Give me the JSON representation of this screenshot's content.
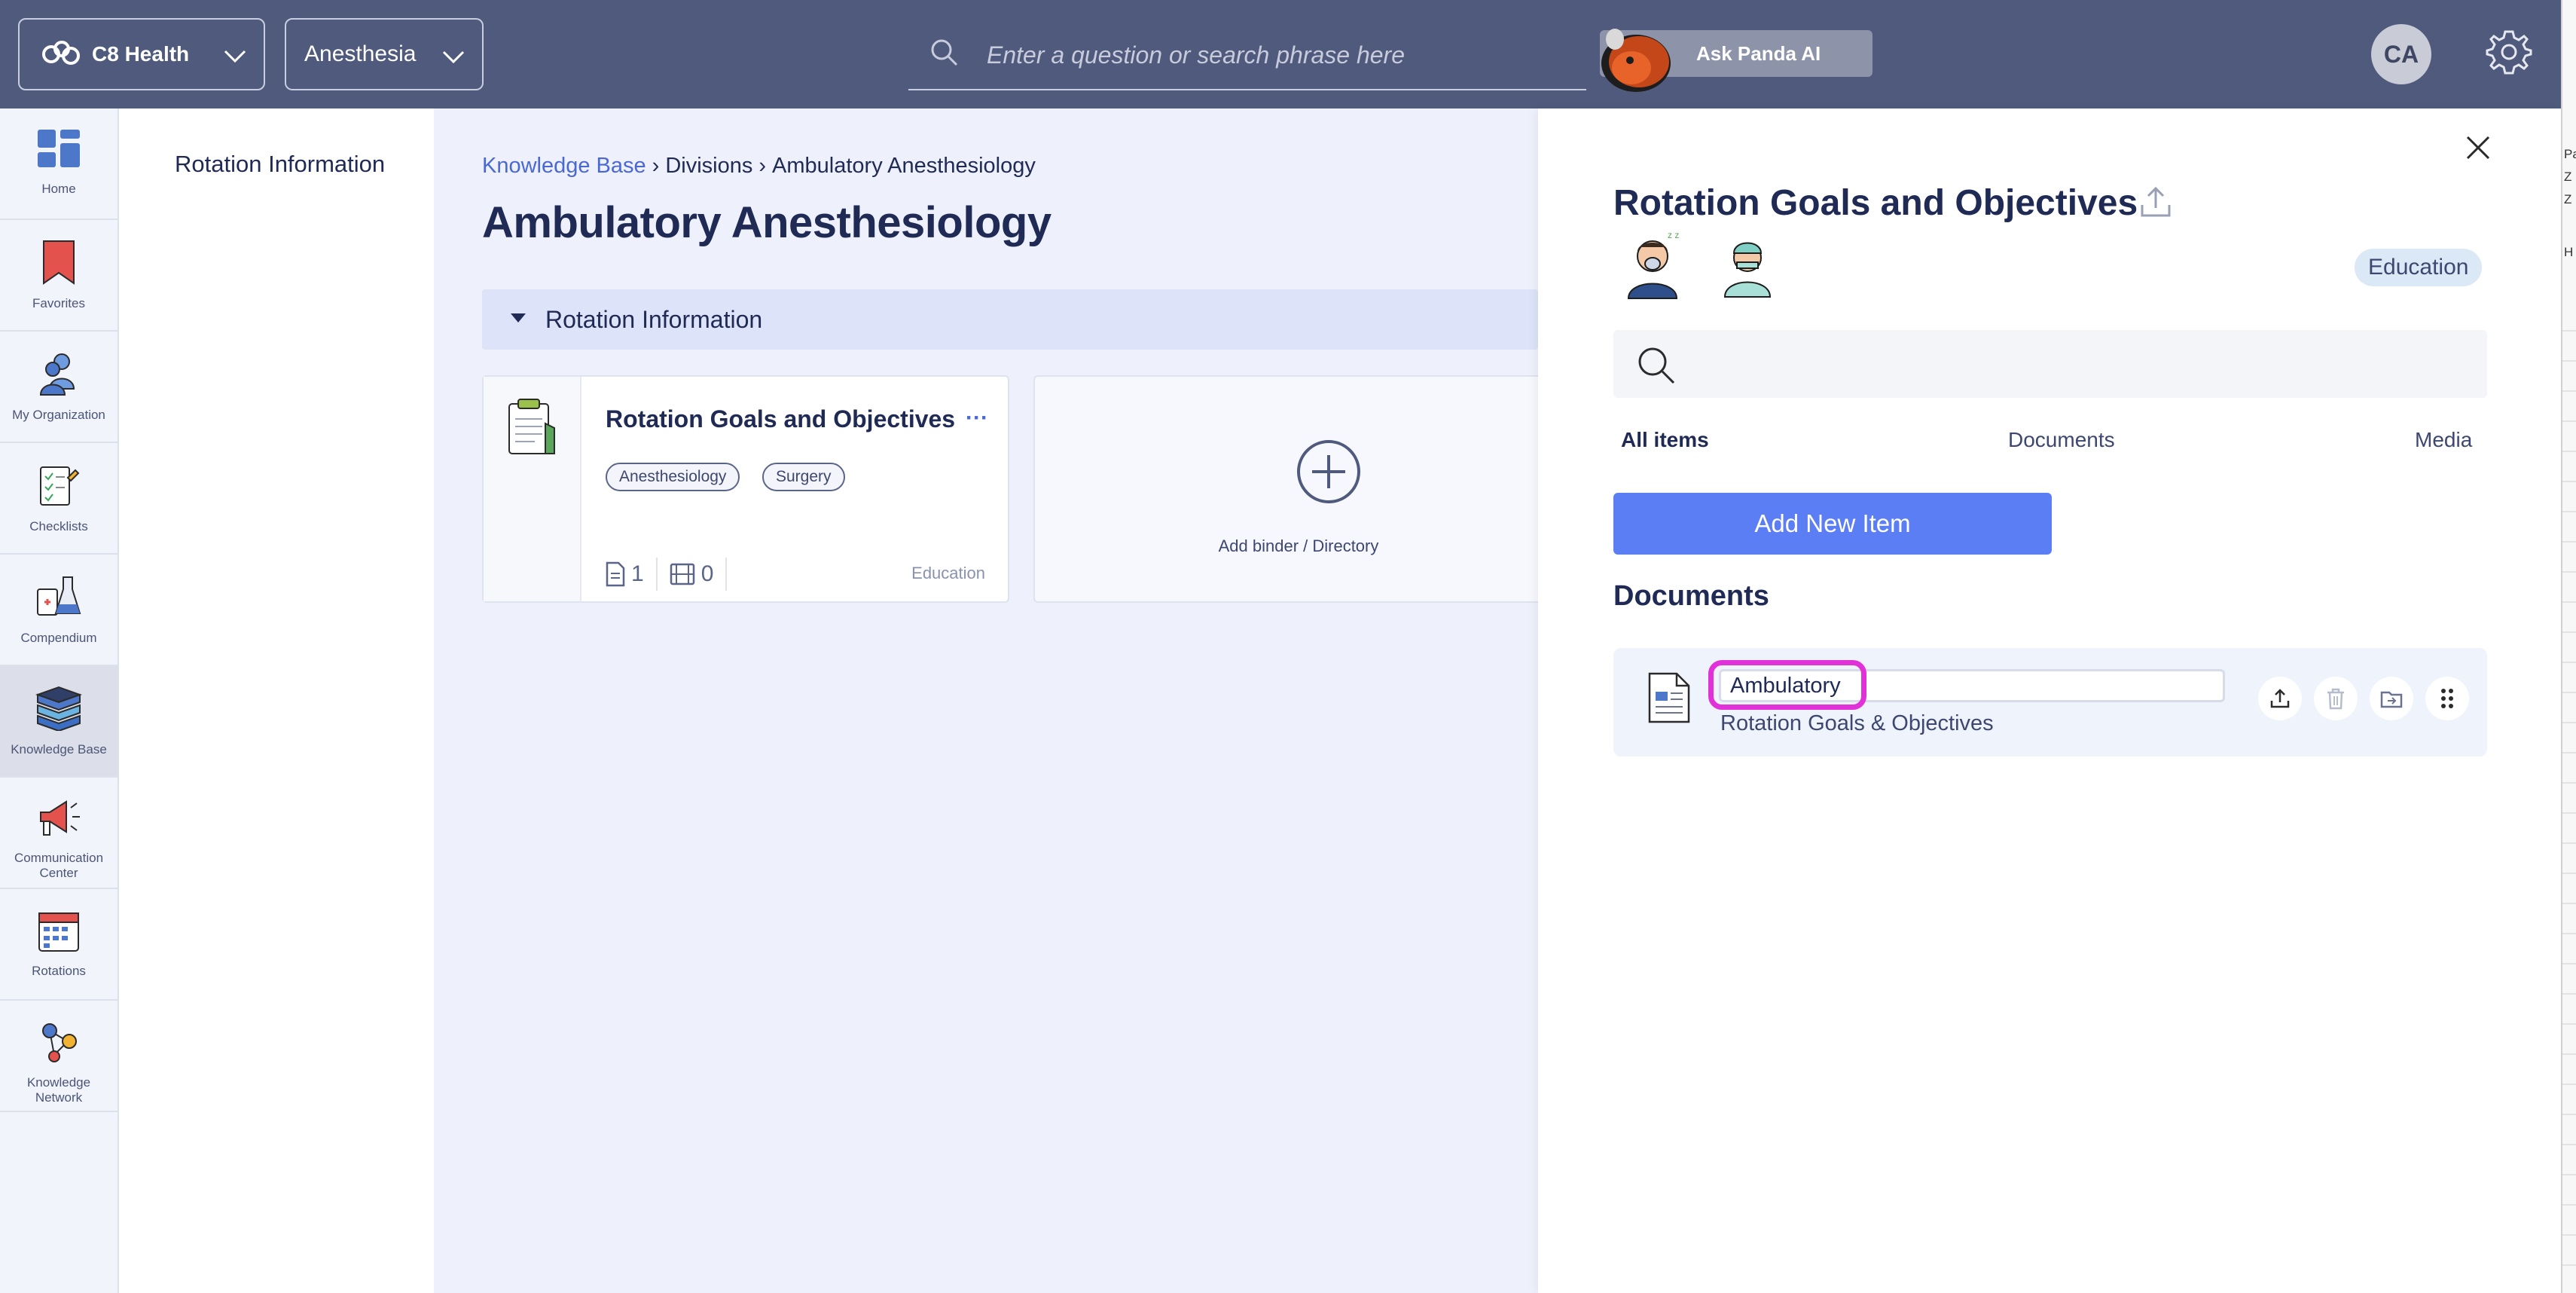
{
  "topbar": {
    "org_name": "C8 Health",
    "department": "Anesthesia",
    "search_placeholder": "Enter a question or search phrase here",
    "panda_label": "Ask Panda AI",
    "user_initials": "CA"
  },
  "sidebar": {
    "items": [
      {
        "label": "Home",
        "icon": "home-grid-icon"
      },
      {
        "label": "Favorites",
        "icon": "bookmark-icon"
      },
      {
        "label": "My Organization",
        "icon": "people-icon"
      },
      {
        "label": "Checklists",
        "icon": "checklist-icon"
      },
      {
        "label": "Compendium",
        "icon": "flask-icon"
      },
      {
        "label": "Knowledge Base",
        "icon": "books-icon"
      },
      {
        "label": "Communication Center",
        "icon": "megaphone-icon"
      },
      {
        "label": "Rotations",
        "icon": "calendar-icon"
      },
      {
        "label": "Knowledge Network",
        "icon": "network-icon"
      }
    ],
    "active": "Knowledge Base"
  },
  "tree": {
    "item": "Rotation Information"
  },
  "main": {
    "breadcrumb": [
      "Knowledge Base",
      "Divisions",
      "Ambulatory Anesthesiology"
    ],
    "title": "Ambulatory Anesthesiology",
    "section": "Rotation Information",
    "card": {
      "title": "Rotation Goals and Objectives",
      "tags": [
        "Anesthesiology",
        "Surgery"
      ],
      "documents_count": "1",
      "media_count": "0",
      "category": "Education"
    },
    "add_card_label": "Add binder / Directory"
  },
  "panel": {
    "title": "Rotation Goals and Objectives",
    "badge": "Education",
    "tabs": [
      "All items",
      "Documents",
      "Media"
    ],
    "active_tab": "All items",
    "add_button": "Add New Item",
    "documents_heading": "Documents",
    "document": {
      "name_value": "Ambulatory",
      "subtitle": "Rotation Goals & Objectives"
    }
  },
  "edge_text": [
    "Pa",
    "Z",
    "Z",
    "H"
  ],
  "colors": {
    "topbar": "#4f5a7c",
    "primary_button": "#5b7ef5",
    "link": "#4a68d4",
    "highlight": "#e032d8"
  }
}
